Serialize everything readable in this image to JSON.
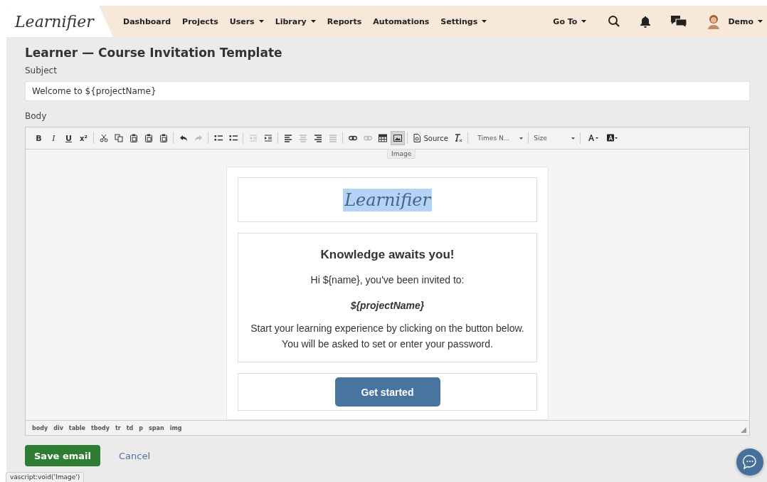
{
  "header": {
    "logo": "Learnifier",
    "nav": [
      {
        "label": "Dashboard",
        "dropdown": false
      },
      {
        "label": "Projects",
        "dropdown": false
      },
      {
        "label": "Users",
        "dropdown": true
      },
      {
        "label": "Library",
        "dropdown": true
      },
      {
        "label": "Reports",
        "dropdown": false
      },
      {
        "label": "Automations",
        "dropdown": false
      },
      {
        "label": "Settings",
        "dropdown": true
      }
    ],
    "goto": "Go To",
    "user": "Demo"
  },
  "title": "Learner — Course Invitation Template",
  "subject": {
    "label": "Subject",
    "value": "Welcome to ${projectName}"
  },
  "body": {
    "label": "Body",
    "toolbar": [
      [
        {
          "kind": "bold",
          "text": "B",
          "active": false,
          "disabled": false
        },
        {
          "kind": "italic",
          "text": "I",
          "active": false,
          "disabled": false
        },
        {
          "kind": "underline",
          "text": "U",
          "active": false,
          "disabled": false
        },
        {
          "kind": "superscript",
          "text": "x²",
          "active": false,
          "disabled": false
        }
      ],
      [
        {
          "kind": "cut",
          "active": false,
          "disabled": false
        },
        {
          "kind": "copy",
          "active": false,
          "disabled": false
        },
        {
          "kind": "paste",
          "active": false,
          "disabled": false
        },
        {
          "kind": "paste-text",
          "active": false,
          "disabled": false
        },
        {
          "kind": "paste-word",
          "active": false,
          "disabled": false
        }
      ],
      [
        {
          "kind": "undo",
          "active": false,
          "disabled": false
        },
        {
          "kind": "redo",
          "active": false,
          "disabled": true
        }
      ],
      [
        {
          "kind": "numbered-list",
          "active": false,
          "disabled": false
        },
        {
          "kind": "bullet-list",
          "active": false,
          "disabled": false
        }
      ],
      [
        {
          "kind": "outdent",
          "active": false,
          "disabled": true
        },
        {
          "kind": "indent",
          "active": false,
          "disabled": false
        }
      ],
      [
        {
          "kind": "align-left",
          "active": false,
          "disabled": false
        },
        {
          "kind": "align-center",
          "active": false,
          "disabled": true
        },
        {
          "kind": "align-right",
          "active": false,
          "disabled": false
        },
        {
          "kind": "justify",
          "active": false,
          "disabled": true
        }
      ],
      [
        {
          "kind": "link",
          "active": false,
          "disabled": false
        },
        {
          "kind": "unlink",
          "active": false,
          "disabled": true
        },
        {
          "kind": "table",
          "active": false,
          "disabled": false
        },
        {
          "kind": "image",
          "active": true,
          "disabled": false
        }
      ],
      [
        {
          "kind": "source",
          "text": "Source",
          "active": false,
          "disabled": false
        },
        {
          "kind": "clear-format",
          "active": false,
          "disabled": false
        }
      ]
    ],
    "font": "Times N...",
    "size": "Size",
    "tooltip": "Image",
    "email": {
      "logo": "Learnifier",
      "logo_selected": true,
      "heading": "Knowledge awaits you!",
      "greeting": "Hi ${name}, you've been invited to:",
      "project": "${projectName}",
      "lines": [
        "Start your learning experience by clicking on the button below.",
        "You will be asked to set or enter your password."
      ],
      "button": "Get started"
    },
    "path": [
      "body",
      "div",
      "table",
      "tbody",
      "tr",
      "td",
      "p",
      "span",
      "img"
    ]
  },
  "actions": {
    "save": "Save email",
    "cancel": "Cancel"
  },
  "status_url": "vascript:void('Image')"
}
